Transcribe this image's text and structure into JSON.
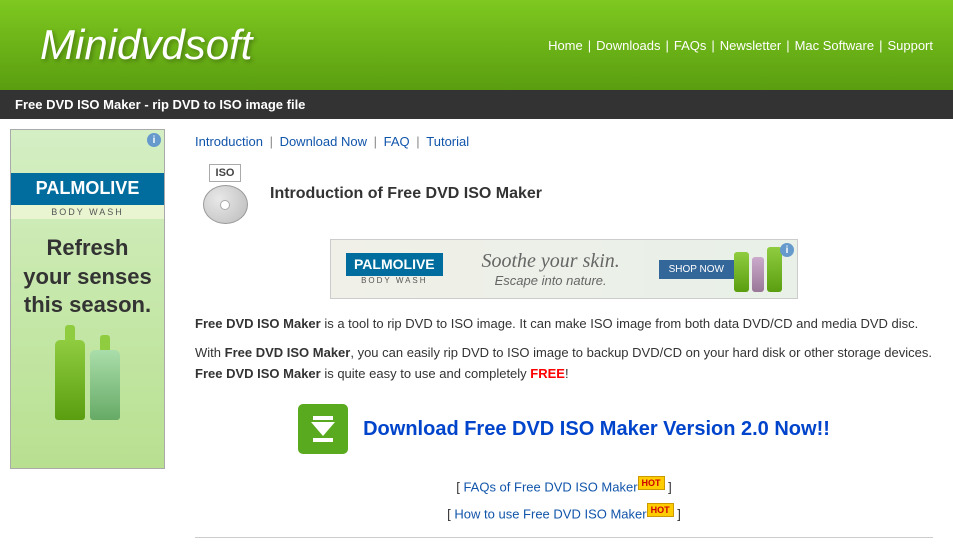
{
  "header": {
    "logo": "Minidvdsoft",
    "nav_items": [
      {
        "label": "Home",
        "url": "#"
      },
      {
        "label": "Downloads",
        "url": "#"
      },
      {
        "label": "FAQs",
        "url": "#"
      },
      {
        "label": "Newsletter",
        "url": "#"
      },
      {
        "label": "Mac Software",
        "url": "#"
      },
      {
        "label": "Support",
        "url": "#"
      }
    ]
  },
  "title_bar": {
    "text": "Free DVD ISO Maker - rip DVD to ISO image file"
  },
  "breadcrumb": {
    "items": [
      {
        "label": "Introduction",
        "url": "#"
      },
      {
        "label": "Download Now",
        "url": "#"
      },
      {
        "label": "FAQ",
        "url": "#"
      },
      {
        "label": "Tutorial",
        "url": "#"
      }
    ]
  },
  "product": {
    "title": "Introduction of Free DVD ISO Maker",
    "description1": " is a tool to rip DVD to ISO image. It can make ISO image from both data DVD/CD and media DVD disc.",
    "description1_prefix": "Free DVD ISO Maker",
    "description2_prefix": "With ",
    "description2_bold1": "Free DVD ISO Maker",
    "description2_middle": ", you can easily rip DVD to ISO image to backup DVD/CD on your hard disk or other storage devices. ",
    "description2_bold2": "Free DVD ISO Maker",
    "description2_suffix": " is quite easy to use and completely ",
    "free_text": "FREE",
    "free_suffix": "!"
  },
  "download": {
    "title": "Download Free DVD ISO Maker Version 2.0 Now!!"
  },
  "faq_links": {
    "faq_text": "FAQs of Free DVD ISO Maker",
    "faq_badge": "HOT",
    "howto_text": "How to use Free DVD ISO Maker",
    "howto_badge": "HOT"
  },
  "ad": {
    "brand": "PALMOLIVE",
    "sub": "BODY WASH",
    "slogan1": "Soothe your skin.",
    "slogan2": "Escape into nature.",
    "shop_btn": "SHOP NOW",
    "sidebar_text": "Refresh your senses this season.",
    "info": "i"
  }
}
